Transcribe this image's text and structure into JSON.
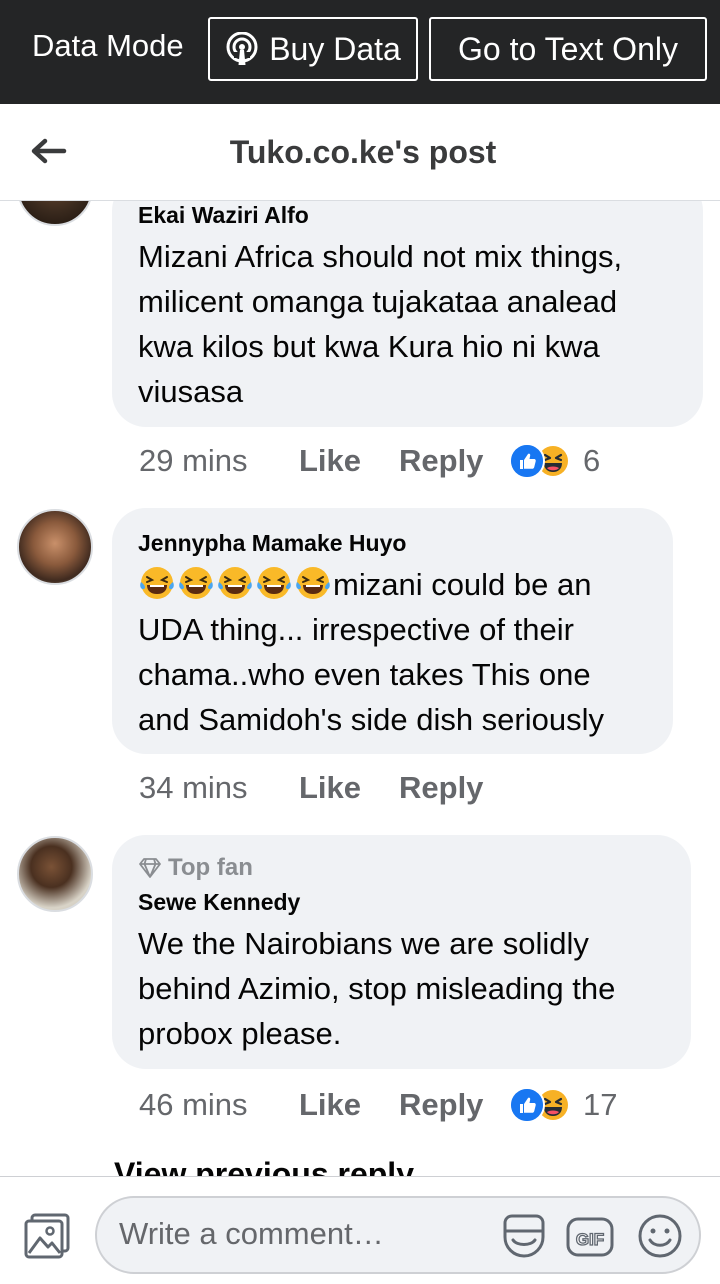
{
  "topbar": {
    "mode_label": "Data Mode",
    "buy_data_label": "Buy Data",
    "text_only_label": "Go to Text Only"
  },
  "header": {
    "title": "Tuko.co.ke's post"
  },
  "comments": [
    {
      "author": "Ekai Waziri Alfo",
      "text_lines": [
        "Mizani Africa should not mix things,",
        "milicent omanga tujakataa analead",
        "kwa kilos but kwa Kura hio ni kwa",
        "viusasa"
      ],
      "time": "29 mins",
      "like_label": "Like",
      "reply_label": "Reply",
      "reaction_count": "6"
    },
    {
      "author": "Jennypha Mamake Huyo",
      "text_lines": [
        "mizani could be an",
        "UDA thing... irrespective of their",
        "chama..who even takes This one",
        "and Samidoh's side dish seriously"
      ],
      "time": "34 mins",
      "like_label": "Like",
      "reply_label": "Reply"
    },
    {
      "badge": "Top fan",
      "author": "Sewe Kennedy",
      "text_lines": [
        "We the Nairobians we are solidly",
        "behind Azimio, stop misleading the",
        "probox please."
      ],
      "time": "46 mins",
      "like_label": "Like",
      "reply_label": "Reply",
      "reaction_count": "17"
    }
  ],
  "view_previous": "View previous reply",
  "composer": {
    "placeholder": "Write a comment…",
    "gif_label": "GIF"
  },
  "colors": {
    "topbar_bg": "#242526",
    "bubble_bg": "#f0f2f5",
    "like_blue": "#1877f2",
    "meta_gray": "#65676b"
  },
  "icons": [
    "back-arrow-icon",
    "podcast-icon",
    "like-reaction-icon",
    "haha-reaction-icon",
    "tears-of-joy-emoji",
    "diamond-icon",
    "photo-icon",
    "sticker-icon",
    "gif-icon",
    "smiley-icon"
  ]
}
